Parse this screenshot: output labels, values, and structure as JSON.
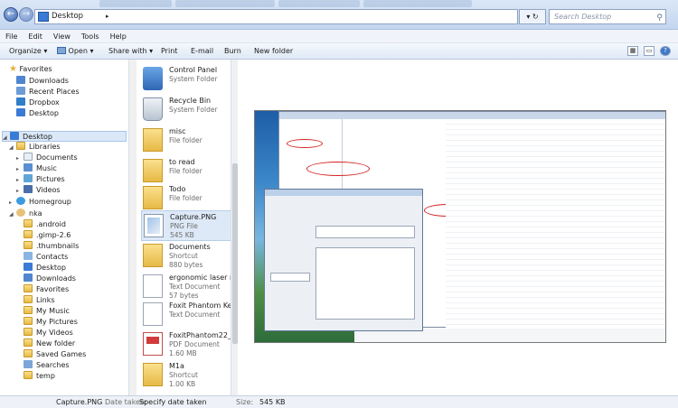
{
  "address": {
    "path": "Desktop",
    "search_placeholder": "Search Desktop"
  },
  "menu": [
    "File",
    "Edit",
    "View",
    "Tools",
    "Help"
  ],
  "toolbar": {
    "organize": "Organize",
    "open": "Open",
    "share_with": "Share with",
    "print": "Print",
    "email": "E-mail",
    "burn": "Burn",
    "new_folder": "New folder"
  },
  "nav": {
    "favorites": "Favorites",
    "fav_items": [
      "Downloads",
      "Recent Places",
      "Dropbox",
      "Desktop"
    ],
    "desktop": "Desktop",
    "libraries": "Libraries",
    "lib_items": [
      "Documents",
      "Music",
      "Pictures",
      "Videos"
    ],
    "homegroup": "Homegroup",
    "user": "nka",
    "user_items": [
      ".android",
      ".gimp-2.6",
      ".thumbnails",
      "Contacts",
      "Desktop",
      "Downloads",
      "Favorites",
      "Links",
      "My Music",
      "My Pictures",
      "My Videos",
      "New folder",
      "Saved Games",
      "Searches",
      "temp"
    ]
  },
  "files": [
    {
      "name": "Control Panel",
      "type": "System Folder",
      "size": "",
      "icon": "control-panel-icon"
    },
    {
      "name": "Recycle Bin",
      "type": "System Folder",
      "size": "",
      "icon": "recycle-bin-icon"
    },
    {
      "name": "misc",
      "type": "File folder",
      "size": "",
      "icon": "folder-icon"
    },
    {
      "name": "to read",
      "type": "File folder",
      "size": "",
      "icon": "folder-icon"
    },
    {
      "name": "Todo",
      "type": "File folder",
      "size": "",
      "icon": "folder-icon"
    },
    {
      "name": "Capture.PNG",
      "type": "PNG File",
      "size": "545 KB",
      "icon": "image-file-icon"
    },
    {
      "name": "Documents",
      "type": "Shortcut",
      "size": "880 bytes",
      "icon": "shortcut-icon"
    },
    {
      "name": "ergonomic laser mou",
      "type": "Text Document",
      "size": "57 bytes",
      "icon": "text-file-icon"
    },
    {
      "name": "Foxit Phantom Keybo",
      "type": "Text Document",
      "size": "",
      "icon": "text-file-icon"
    },
    {
      "name": "FoxitPhantom22_Man",
      "type": "PDF Document",
      "size": "1.60 MB",
      "icon": "pdf-file-icon"
    },
    {
      "name": "M1a",
      "type": "Shortcut",
      "size": "1.00 KB",
      "icon": "shortcut-icon"
    }
  ],
  "status": {
    "name": "Capture.PNG",
    "date_label": "Date taken:",
    "date_value": "Specify date taken",
    "size_label": "Size:",
    "size_value": "545 KB"
  }
}
